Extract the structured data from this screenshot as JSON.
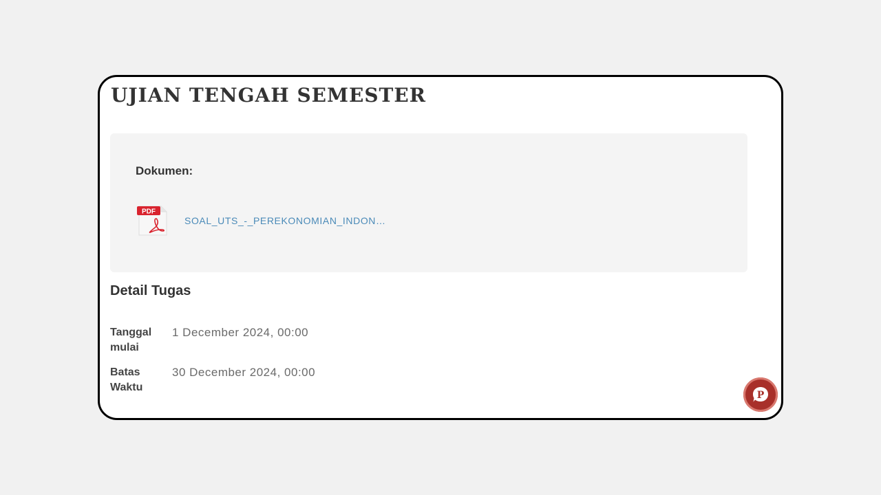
{
  "page": {
    "title": "UJIAN TENGAH SEMESTER"
  },
  "document": {
    "label": "Dokumen:",
    "file": {
      "name": "SOAL_UTS_-_PEREKONOMIAN_INDON…",
      "icon": "pdf-file-icon",
      "icon_badge": "PDF"
    }
  },
  "details": {
    "heading": "Detail Tugas",
    "rows": [
      {
        "label": "Tanggal mulai",
        "value": "1 December 2024, 00:00"
      },
      {
        "label": "Batas Waktu",
        "value": "30 December 2024, 00:00"
      }
    ]
  },
  "chat_button": {
    "icon": "p-chat-icon",
    "letter": "P",
    "color": "#a8302a"
  },
  "colors": {
    "background": "#f1f1f1",
    "card_border": "#000000",
    "panel": "#f4f4f4",
    "link": "#4a8ab8",
    "pdf_red": "#d9232e"
  }
}
